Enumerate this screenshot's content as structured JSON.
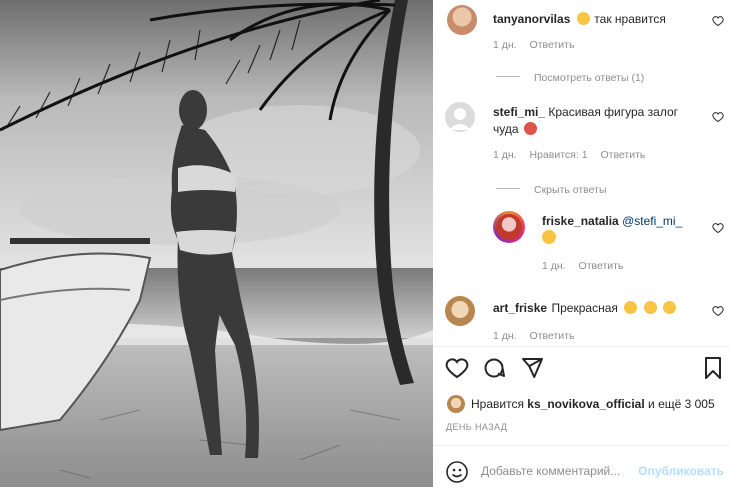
{
  "comments": [
    {
      "username": "tanyanorvilas",
      "text": "так нравится",
      "emojis": [
        "heart-eyes"
      ],
      "meta": {
        "time": "1 дн.",
        "reply": "Ответить"
      },
      "view_replies": "Посмотреть ответы (1)"
    },
    {
      "username": "stefi_mi_",
      "text_line1": "Красивая фигура залог",
      "text_line2": "чуда",
      "emojis": [
        "tongue-face"
      ],
      "meta": {
        "time": "1 дн.",
        "likes": "Нравится: 1",
        "reply": "Ответить"
      },
      "hide_replies": "Скрыть ответы"
    },
    {
      "username": "friske_natalia",
      "mention": "@stefi_mi_",
      "emojis": [
        "smile-face"
      ],
      "meta": {
        "time": "1 дн.",
        "reply": "Ответить"
      }
    },
    {
      "username": "art_friske",
      "text": "Прекрасная",
      "emojis": [
        "heart-eyes",
        "heart-eyes",
        "heart-eyes"
      ],
      "meta": {
        "time": "1 дн.",
        "reply": "Ответить"
      }
    }
  ],
  "actions": {
    "like_icon": "heart-icon",
    "comment_icon": "comment-icon",
    "share_icon": "share-icon",
    "save_icon": "bookmark-icon"
  },
  "likes": {
    "prefix": "Нравится",
    "user": "ks_novikova_official",
    "suffix": "и ещё 3 005"
  },
  "date": "ДЕНЬ НАЗАД",
  "add_comment": {
    "placeholder": "Добавьте комментарий...",
    "publish": "Опубликовать"
  },
  "colors": {
    "publish": "#b2dffc",
    "meta": "#8e8e8e",
    "emoji": "#f7c443"
  }
}
